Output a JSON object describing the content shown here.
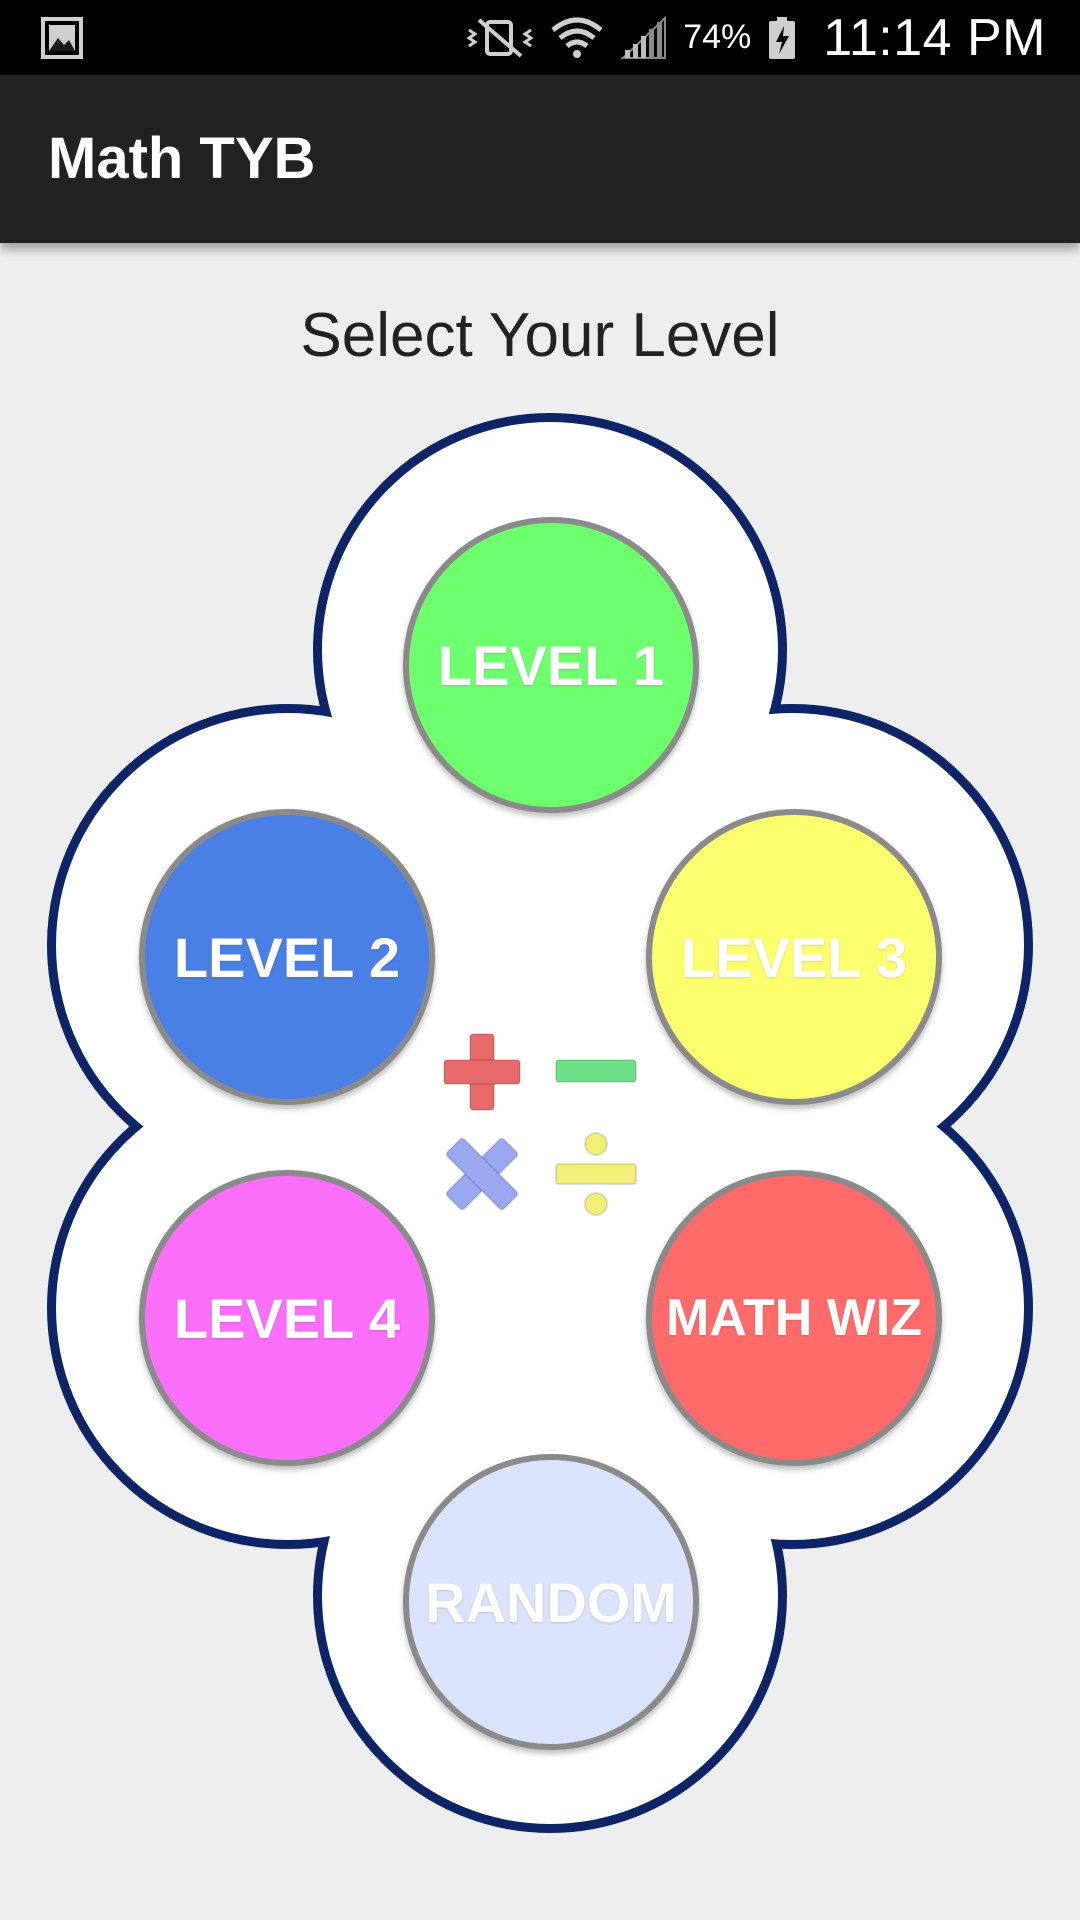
{
  "status_bar": {
    "left_icon": "gallery-icon",
    "icons": [
      "vibrate-mute-icon",
      "wifi-icon",
      "signal-icon"
    ],
    "battery_percent": "74%",
    "battery_icon": "battery-charging-icon",
    "time": "11:14 PM"
  },
  "app_bar": {
    "title": "Math TYB"
  },
  "heading": "Select Your Level",
  "levels": [
    {
      "label": "LEVEL 1",
      "color": "#6eff6e"
    },
    {
      "label": "LEVEL 2",
      "color": "#4a7fe6"
    },
    {
      "label": "LEVEL 3",
      "color": "#fbff6e"
    },
    {
      "label": "LEVEL 4",
      "color": "#fb6ffb"
    },
    {
      "label": "MATH WIZ",
      "color": "#ff6b6b"
    },
    {
      "label": "RANDOM",
      "color": "#dbe3fc"
    }
  ],
  "operators": [
    {
      "name": "plus-icon",
      "color": "#e86a6a"
    },
    {
      "name": "minus-icon",
      "color": "#6ee08a"
    },
    {
      "name": "multiply-icon",
      "color": "#9aa8f0"
    },
    {
      "name": "divide-icon",
      "color": "#f3f07a"
    }
  ],
  "colors": {
    "flower_outline": "#0d2466",
    "flower_fill": "#ffffff",
    "button_border": "#8a8a8a",
    "app_bar": "#212121",
    "background": "#eeeeee"
  }
}
